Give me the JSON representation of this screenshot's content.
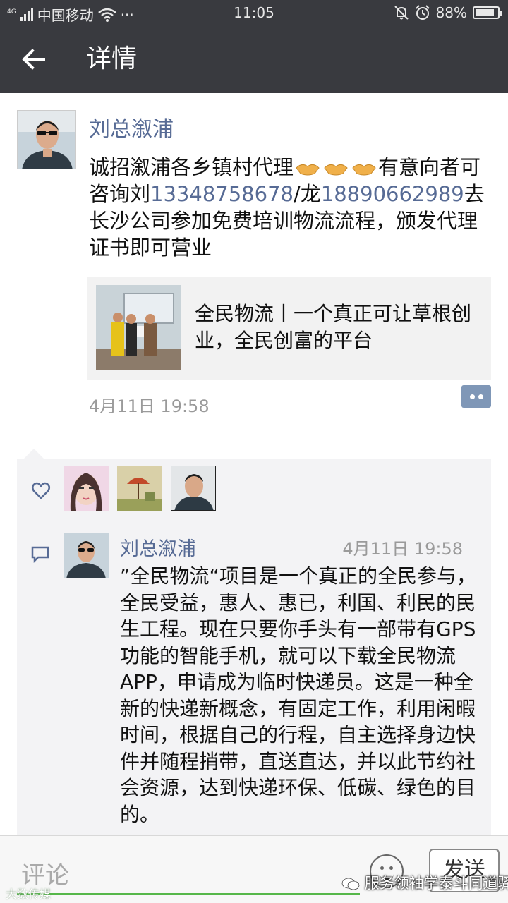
{
  "status_bar": {
    "network_type": "4G",
    "carrier": "中国移动",
    "more": "···",
    "time": "11:05",
    "battery": "88%",
    "battery_level": 0.88
  },
  "title_bar": {
    "title": "详情"
  },
  "post": {
    "author": "刘总溆浦",
    "text_part1": "诚招溆浦各乡镇村代理",
    "text_part2": "有意向者可咨询刘",
    "phone1": "13348758678",
    "slash": "/龙",
    "phone2": "18890662989",
    "text_part3": "去长沙公司参加免费培训物流流程，颁发代理证书即可营业",
    "link_title": "全民物流丨一个真正可让草根创业，全民创富的平台",
    "time": "4月11日 19:58"
  },
  "comment": {
    "author": "刘总溆浦",
    "time": "4月11日 19:58",
    "text": "”全民物流“项目是一个真正的全民参与，全民受益，惠人、惠已，利国、利民的民生工程。现在只要你手头有一部带有GPS功能的智能手机，就可以下载全民物流APP，申请成为临时快递员。这是一种全新的快递新概念，有固定工作，利用闲暇时间，根据自己的行程，自主选择身边快件并随程捎带，直送直达，并以此节约社会资源，达到快递环保、低碳、绿色的目的。"
  },
  "bottom_bar": {
    "placeholder": "评论",
    "send": "发送"
  },
  "watermark": {
    "right": "服务领袖学泰斗同道驿",
    "left": "大数传媒"
  },
  "colors": {
    "bar_bg": "#393a3f",
    "link_blue": "#576b95",
    "accent_green": "#56b74a"
  },
  "icons": [
    "back-arrow-icon",
    "signal-icon",
    "wifi-icon",
    "mute-bell-icon",
    "alarm-icon",
    "battery-icon",
    "handshake-icon",
    "comment-dots-icon",
    "heart-icon",
    "comment-bubble-icon",
    "emoji-icon",
    "wechat-icon"
  ]
}
